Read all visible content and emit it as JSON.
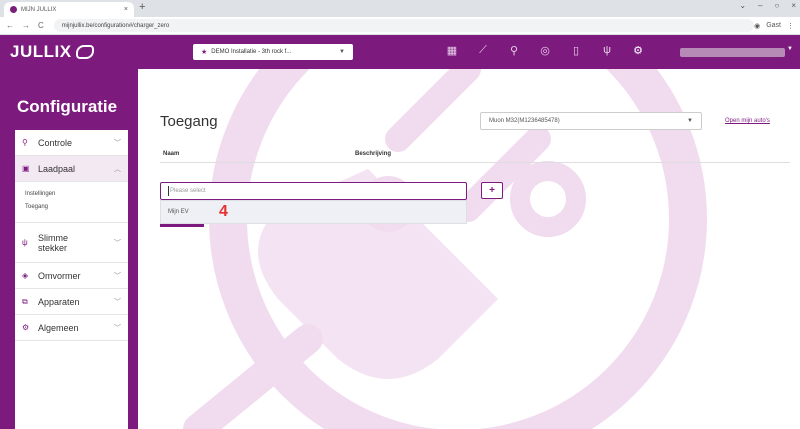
{
  "browser": {
    "tab_title": "MIJN JULLIX",
    "tab_close": "×",
    "new_tab": "+",
    "window_controls": [
      "⌄",
      "–",
      "○",
      "×"
    ],
    "url": "mijnjullix.be/configuration#/charger_zero",
    "nav": [
      "←",
      "→",
      "C"
    ],
    "profile_label": "Gast"
  },
  "app": {
    "brand": "JULLIX",
    "installation_select": "DEMO Installatie - 3th rock f...",
    "icon_names": [
      "dashboard-icon",
      "chart-icon",
      "search-icon",
      "eye-icon",
      "battery-icon",
      "plug-icon",
      "gear-icon"
    ]
  },
  "sidebar": {
    "title": "Configuratie",
    "items": [
      {
        "label": "Controle",
        "icon": "controle-icon"
      },
      {
        "label": "Laadpaal",
        "icon": "laadpaal-icon",
        "open": true,
        "sub": [
          "Instellingen",
          "Toegang"
        ]
      },
      {
        "label": "Slimme stekker",
        "icon": "plug-icon"
      },
      {
        "label": "Omvormer",
        "icon": "inverter-icon"
      },
      {
        "label": "Apparaten",
        "icon": "devices-icon"
      },
      {
        "label": "Algemeen",
        "icon": "gear-icon"
      }
    ]
  },
  "main": {
    "title": "Toegang",
    "device_select": "Muon M32(M1236485478)",
    "open_link": "Open mijn auto's",
    "columns": [
      "Naam",
      "Beschrijving"
    ],
    "select_placeholder": "Please select",
    "dropdown_option": "Mijn EV",
    "annotation": "4",
    "add_button": "+"
  }
}
